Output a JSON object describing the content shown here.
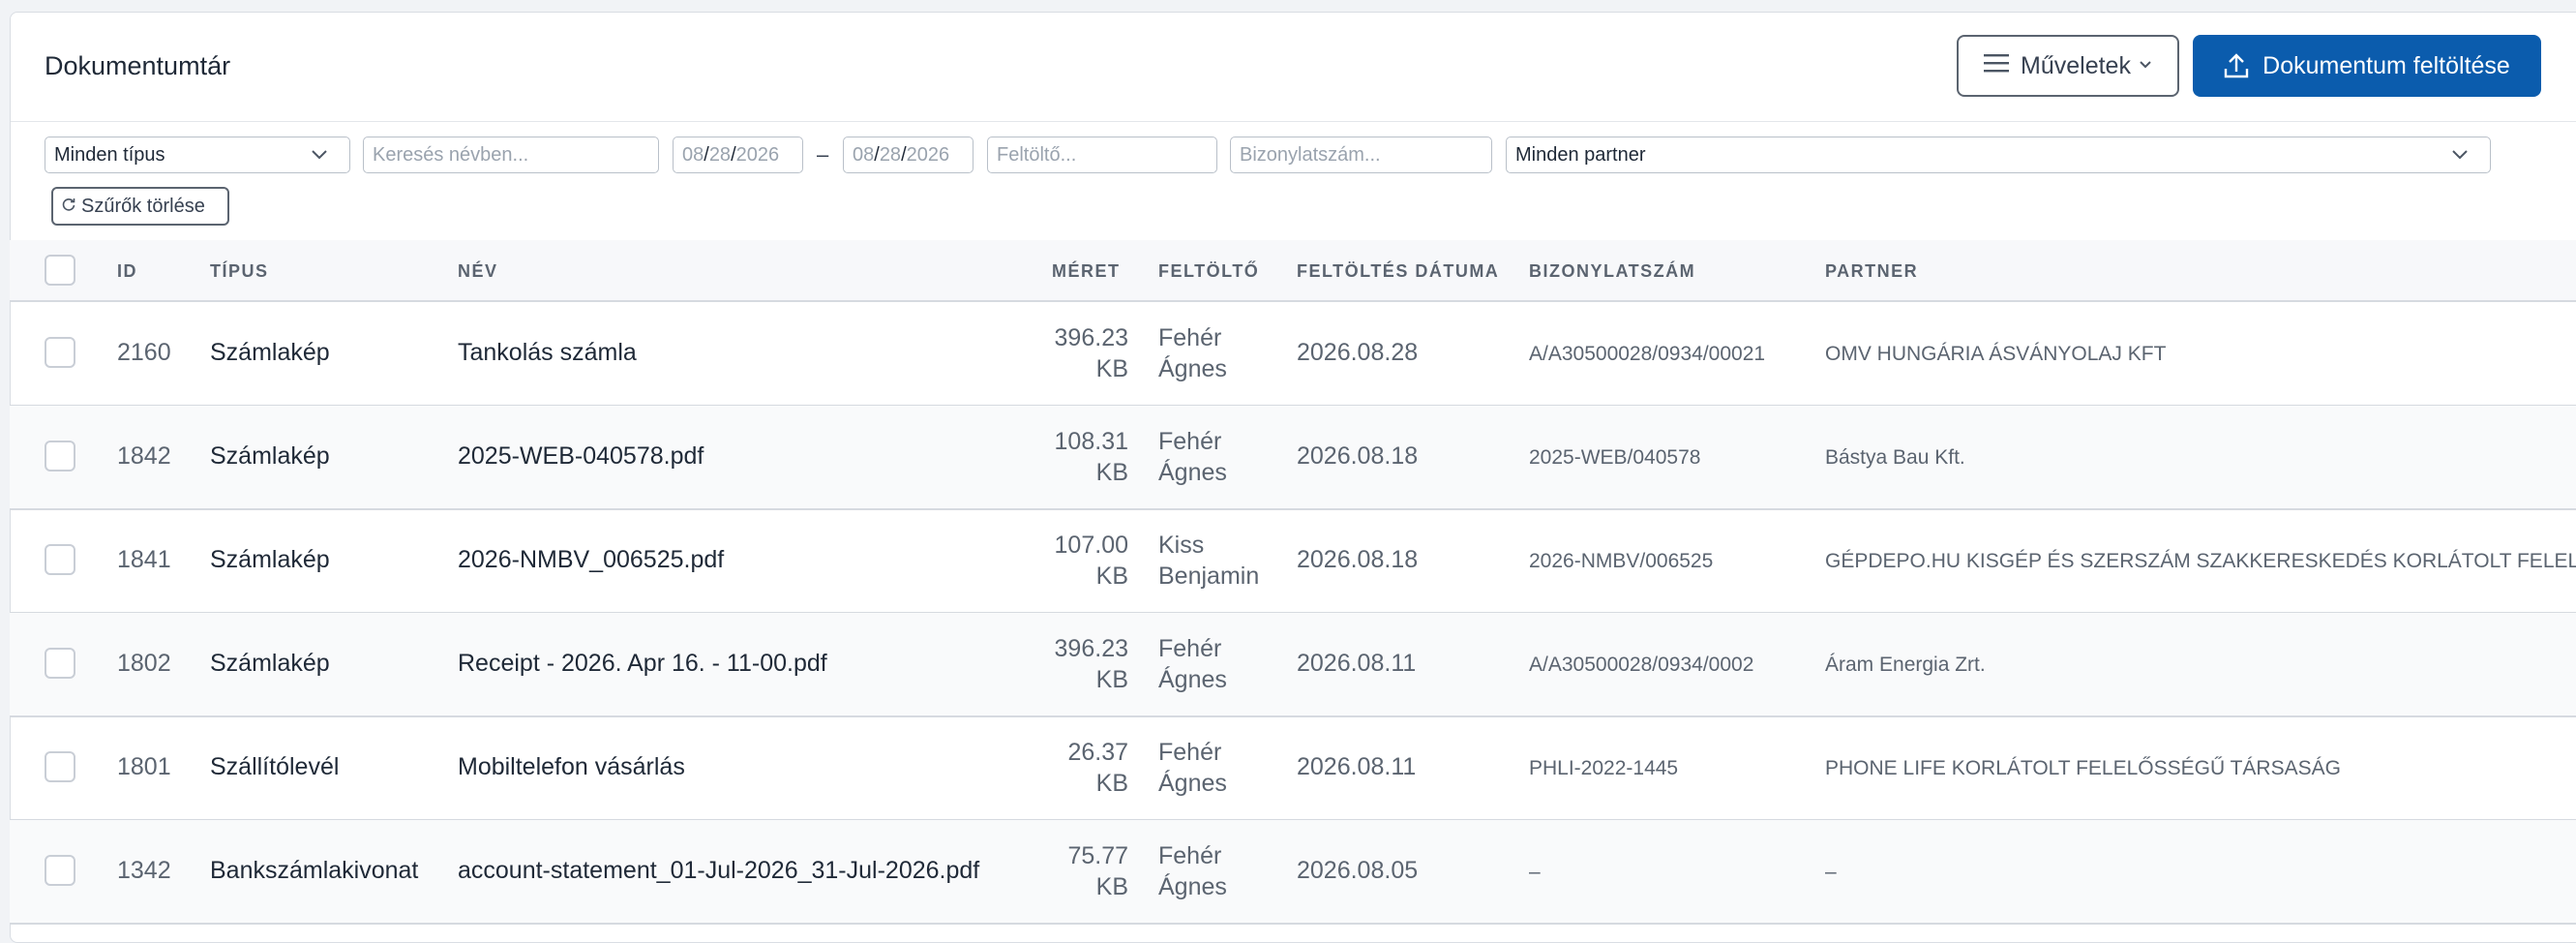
{
  "header": {
    "title": "Dokumentumtár",
    "operations_label": "Műveletek",
    "upload_label": "Dokumentum feltöltése"
  },
  "filters": {
    "type_select": "Minden típus",
    "name_search_placeholder": "Keresés névben...",
    "date_from": {
      "mm": "08",
      "dd": "28",
      "yyyy": "2026"
    },
    "date_separator": "–",
    "date_to": {
      "mm": "08",
      "dd": "28",
      "yyyy": "2026"
    },
    "uploader_placeholder": "Feltöltő...",
    "voucher_placeholder": "Bizonylatszám...",
    "partner_select": "Minden partner",
    "clear_label": "Szűrők törlése"
  },
  "table": {
    "columns": [
      "ID",
      "TÍPUS",
      "NÉV",
      "MÉRET",
      "FELTÖLTŐ",
      "FELTÖLTÉS DÁTUMA",
      "BIZONYLATSZÁM",
      "PARTNER"
    ],
    "rows": [
      {
        "id": "2160",
        "type": "Számlakép",
        "name": "Tankolás számla",
        "size_num": "396.23",
        "size_unit": "KB",
        "uploader_1": "Fehér",
        "uploader_2": "Ágnes",
        "date": "2026.08.28",
        "voucher": "A/A30500028/0934/00021",
        "partner": "OMV HUNGÁRIA ÁSVÁNYOLAJ KFT"
      },
      {
        "id": "1842",
        "type": "Számlakép",
        "name": "2025-WEB-040578.pdf",
        "size_num": "108.31",
        "size_unit": "KB",
        "uploader_1": "Fehér",
        "uploader_2": "Ágnes",
        "date": "2026.08.18",
        "voucher": "2025-WEB/040578",
        "partner": "Bástya Bau Kft."
      },
      {
        "id": "1841",
        "type": "Számlakép",
        "name": "2026-NMBV_006525.pdf",
        "size_num": "107.00",
        "size_unit": "KB",
        "uploader_1": "Kiss",
        "uploader_2": "Benjamin",
        "date": "2026.08.18",
        "voucher": "2026-NMBV/006525",
        "partner": "GÉPDEPO.HU KISGÉP ÉS SZERSZÁM SZAKKERESKEDÉS KORLÁTOLT FELELŐ"
      },
      {
        "id": "1802",
        "type": "Számlakép",
        "name": "Receipt - 2026. Apr 16. - 11-00.pdf",
        "size_num": "396.23",
        "size_unit": "KB",
        "uploader_1": "Fehér",
        "uploader_2": "Ágnes",
        "date": "2026.08.11",
        "voucher": "A/A30500028/0934/0002",
        "partner": "Áram Energia Zrt."
      },
      {
        "id": "1801",
        "type": "Szállítólevél",
        "name": "Mobiltelefon vásárlás",
        "size_num": "26.37",
        "size_unit": "KB",
        "uploader_1": "Fehér",
        "uploader_2": "Ágnes",
        "date": "2026.08.11",
        "voucher": "PHLI-2022-1445",
        "partner": "PHONE LIFE KORLÁTOLT FELELŐSSÉGŰ TÁRSASÁG"
      },
      {
        "id": "1342",
        "type": "Bankszámlakivonat",
        "name": "account-statement_01-Jul-2026_31-Jul-2026.pdf",
        "size_num": "75.77",
        "size_unit": "KB",
        "uploader_1": "Fehér",
        "uploader_2": "Ágnes",
        "date": "2026.08.05",
        "voucher": "–",
        "partner": "–"
      }
    ]
  },
  "colors": {
    "primary": "#0b5cad",
    "border": "#d6dae0",
    "muted_text": "#5b6470"
  }
}
